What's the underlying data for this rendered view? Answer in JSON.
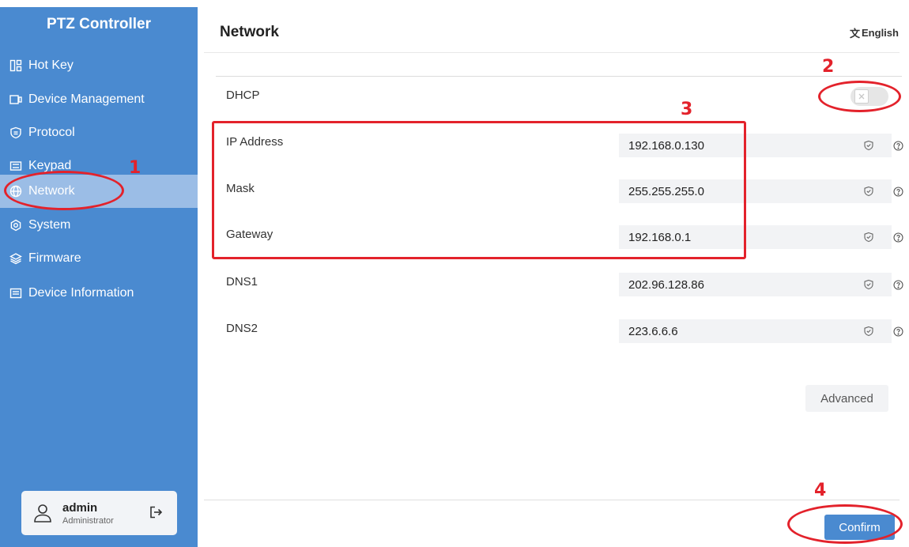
{
  "app": {
    "title": "PTZ Controller"
  },
  "sidebar": {
    "items": [
      {
        "label": "Hot Key",
        "icon": "hotkey-icon"
      },
      {
        "label": "Device Management",
        "icon": "device-icon"
      },
      {
        "label": "Protocol",
        "icon": "protocol-icon"
      },
      {
        "label": "Keypad",
        "icon": "keypad-icon"
      },
      {
        "label": "Network",
        "icon": "globe-icon",
        "active": true
      },
      {
        "label": "System",
        "icon": "gear-icon"
      },
      {
        "label": "Firmware",
        "icon": "layers-icon"
      },
      {
        "label": "Device Information",
        "icon": "info-card-icon"
      }
    ],
    "user": {
      "name": "admin",
      "role": "Administrator"
    }
  },
  "header": {
    "title": "Network",
    "language": "English"
  },
  "form": {
    "dhcp": {
      "label": "DHCP",
      "enabled": false
    },
    "fields": [
      {
        "label": "IP Address",
        "value": "192.168.0.130"
      },
      {
        "label": "Mask",
        "value": "255.255.255.0"
      },
      {
        "label": "Gateway",
        "value": "192.168.0.1"
      },
      {
        "label": "DNS1",
        "value": "202.96.128.86"
      },
      {
        "label": "DNS2",
        "value": "223.6.6.6"
      }
    ],
    "advanced_label": "Advanced",
    "confirm_label": "Confirm"
  },
  "annotations": {
    "n1": "1",
    "n2": "2",
    "n3": "3",
    "n4": "4"
  },
  "colors": {
    "sidebar": "#4a8ad0",
    "active_item": "#9bbde6",
    "annotation": "#e3222b",
    "confirm": "#4a8ad0"
  }
}
